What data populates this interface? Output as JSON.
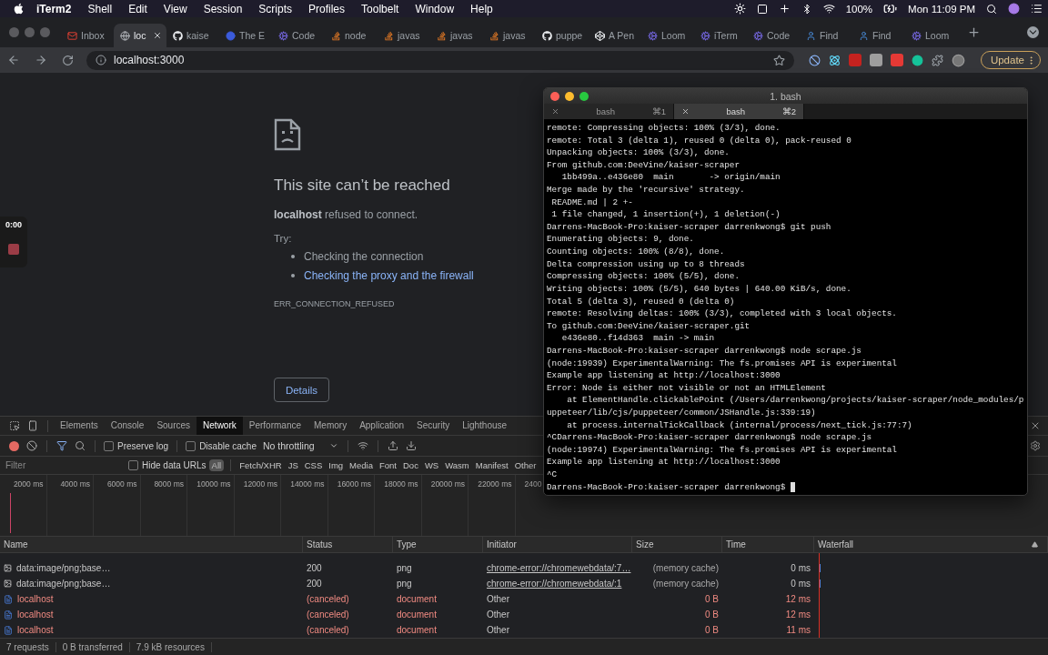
{
  "menu_bar": {
    "app": "iTerm2",
    "menus": [
      "Shell",
      "Edit",
      "View",
      "Session",
      "Scripts",
      "Profiles",
      "Toolbelt",
      "Window",
      "Help"
    ],
    "battery": "100%",
    "clock": "Mon 11:09 PM"
  },
  "browser": {
    "tabs": [
      {
        "title": "Inbox",
        "kind": "mail",
        "selected": false
      },
      {
        "title": "loc",
        "kind": "globe",
        "selected": true
      },
      {
        "title": "kaise",
        "kind": "github",
        "selected": false
      },
      {
        "title": "The E",
        "kind": "dot",
        "selected": false
      },
      {
        "title": "Code",
        "kind": "cog",
        "selected": false
      },
      {
        "title": "node",
        "kind": "stack",
        "selected": false
      },
      {
        "title": "javas",
        "kind": "stack",
        "selected": false
      },
      {
        "title": "javas",
        "kind": "stack",
        "selected": false
      },
      {
        "title": "javas",
        "kind": "stack",
        "selected": false
      },
      {
        "title": "puppe",
        "kind": "github",
        "selected": false
      },
      {
        "title": "A Pen",
        "kind": "codepen",
        "selected": false
      },
      {
        "title": "Loom",
        "kind": "cog",
        "selected": false
      },
      {
        "title": "iTerm",
        "kind": "cog",
        "selected": false
      },
      {
        "title": "Code",
        "kind": "cog",
        "selected": false
      },
      {
        "title": "Find",
        "kind": "person",
        "selected": false
      },
      {
        "title": "Find",
        "kind": "person",
        "selected": false
      },
      {
        "title": "Loom",
        "kind": "cog",
        "selected": false
      }
    ],
    "address": "localhost:3000",
    "update_button": "Update"
  },
  "page": {
    "title": "This site can’t be reached",
    "message": "**localhost** refused to connect.",
    "try_label": "Try:",
    "suggestions": [
      {
        "text": "Checking the connection",
        "kind": "text"
      },
      {
        "text": "Checking the proxy and the firewall",
        "kind": "link"
      }
    ],
    "error_code": "ERR_CONNECTION_REFUSED",
    "details_button": "Details"
  },
  "recording": {
    "timer": "0:00"
  },
  "devtools": {
    "tabs": [
      {
        "label": "Elements",
        "selected": false
      },
      {
        "label": "Console",
        "selected": false
      },
      {
        "label": "Sources",
        "selected": false
      },
      {
        "label": "Network",
        "selected": true
      },
      {
        "label": "Performance",
        "selected": false
      },
      {
        "label": "Memory",
        "selected": false
      },
      {
        "label": "Application",
        "selected": false
      },
      {
        "label": "Security",
        "selected": false
      },
      {
        "label": "Lighthouse",
        "selected": false
      }
    ],
    "toolbar": {
      "recording": true,
      "preserve_log": {
        "label": "Preserve log",
        "checked": false
      },
      "disable_cache": {
        "label": "Disable cache",
        "checked": false
      },
      "throttling": "No throttling"
    },
    "filter": {
      "placeholder": "Filter",
      "hide_data_urls": {
        "label": "Hide data URLs",
        "checked": false
      },
      "types": [
        {
          "label": "All",
          "selected": true
        },
        {
          "label": "Fetch/XHR",
          "selected": false
        },
        {
          "label": "JS",
          "selected": false
        },
        {
          "label": "CSS",
          "selected": false
        },
        {
          "label": "Img",
          "selected": false
        },
        {
          "label": "Media",
          "selected": false
        },
        {
          "label": "Font",
          "selected": false
        },
        {
          "label": "Doc",
          "selected": false
        },
        {
          "label": "WS",
          "selected": false
        },
        {
          "label": "Wasm",
          "selected": false
        },
        {
          "label": "Manifest",
          "selected": false
        },
        {
          "label": "Other",
          "selected": false
        }
      ]
    },
    "timeline_ticks": [
      "2000 ms",
      "4000 ms",
      "6000 ms",
      "8000 ms",
      "10000 ms",
      "12000 ms",
      "14000 ms",
      "16000 ms",
      "18000 ms",
      "20000 ms",
      "22000 ms",
      "2400"
    ],
    "table": {
      "columns": [
        "Name",
        "Status",
        "Type",
        "Initiator",
        "Size",
        "Time",
        "Waterfall"
      ],
      "rows": [
        {
          "name": "data:image/png;base…",
          "kind": "image",
          "status": "200",
          "type": "png",
          "initiator": "chrome-error://chromewebdata/:7…",
          "initiator_link": true,
          "size": "(memory cache)",
          "time": "0 ms",
          "failed": false
        },
        {
          "name": "data:image/png;base…",
          "kind": "image",
          "status": "200",
          "type": "png",
          "initiator": "chrome-error://chromewebdata/:1",
          "initiator_link": true,
          "size": "(memory cache)",
          "time": "0 ms",
          "failed": false
        },
        {
          "name": "localhost",
          "kind": "document",
          "status": "(canceled)",
          "type": "document",
          "initiator": "Other",
          "initiator_link": false,
          "size": "0 B",
          "time": "12 ms",
          "failed": true
        },
        {
          "name": "localhost",
          "kind": "document",
          "status": "(canceled)",
          "type": "document",
          "initiator": "Other",
          "initiator_link": false,
          "size": "0 B",
          "time": "12 ms",
          "failed": true
        },
        {
          "name": "localhost",
          "kind": "document",
          "status": "(canceled)",
          "type": "document",
          "initiator": "Other",
          "initiator_link": false,
          "size": "0 B",
          "time": "11 ms",
          "failed": true
        }
      ]
    },
    "status_bar": [
      "7 requests",
      "0 B transferred",
      "7.9 kB resources"
    ]
  },
  "terminal": {
    "title": "1. bash",
    "tabs": [
      {
        "label": "bash",
        "shortcut": "⌘1",
        "selected": false
      },
      {
        "label": "bash",
        "shortcut": "⌘2",
        "selected": true
      }
    ],
    "cursor_visible": true,
    "lines": [
      "remote: Compressing objects: 100% (3/3), done.",
      "remote: Total 3 (delta 1), reused 0 (delta 0), pack-reused 0",
      "Unpacking objects: 100% (3/3), done.",
      "From github.com:DeeVine/kaiser-scraper",
      "   1bb499a..e436e80  main       -> origin/main",
      "Merge made by the 'recursive' strategy.",
      " README.md | 2 +-",
      " 1 file changed, 1 insertion(+), 1 deletion(-)",
      "Darrens-MacBook-Pro:kaiser-scraper darrenkwong$ git push",
      "Enumerating objects: 9, done.",
      "Counting objects: 100% (8/8), done.",
      "Delta compression using up to 8 threads",
      "Compressing objects: 100% (5/5), done.",
      "Writing objects: 100% (5/5), 640 bytes | 640.00 KiB/s, done.",
      "Total 5 (delta 3), reused 0 (delta 0)",
      "remote: Resolving deltas: 100% (3/3), completed with 3 local objects.",
      "To github.com:DeeVine/kaiser-scraper.git",
      "   e436e80..f14d363  main -> main",
      "Darrens-MacBook-Pro:kaiser-scraper darrenkwong$ node scrape.js",
      "(node:19939) ExperimentalWarning: The fs.promises API is experimental",
      "Example app listening at http://localhost:3000",
      "Error: Node is either not visible or not an HTMLElement",
      "    at ElementHandle.clickablePoint (/Users/darrenkwong/projects/kaiser-scraper/node_modules/p",
      "uppeteer/lib/cjs/puppeteer/common/JSHandle.js:339:19)",
      "    at process.internalTickCallback (internal/process/next_tick.js:77:7)",
      "^CDarrens-MacBook-Pro:kaiser-scraper darrenkwong$ node scrape.js",
      "(node:19974) ExperimentalWarning: The fs.promises API is experimental",
      "Example app listening at http://localhost:3000",
      "^C",
      "Darrens-MacBook-Pro:kaiser-scraper darrenkwong$ "
    ]
  }
}
